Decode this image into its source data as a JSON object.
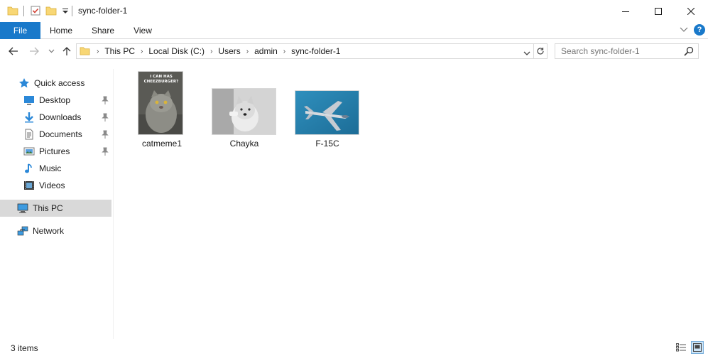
{
  "window": {
    "title": "sync-folder-1",
    "minimize_glyph": "—",
    "maximize_glyph": "☐",
    "close_glyph": "✕"
  },
  "ribbon": {
    "tabs": [
      "File",
      "Home",
      "Share",
      "View"
    ],
    "accent": "#1979ca",
    "help": "?"
  },
  "address": {
    "crumbs": [
      "This PC",
      "Local Disk (C:)",
      "Users",
      "admin",
      "sync-folder-1"
    ]
  },
  "search": {
    "placeholder": "Search sync-folder-1"
  },
  "sidebar": {
    "quick_access": "Quick access",
    "items": [
      {
        "label": "Desktop",
        "icon": "desktop-icon",
        "pinned": true
      },
      {
        "label": "Downloads",
        "icon": "downloads-icon",
        "pinned": true
      },
      {
        "label": "Documents",
        "icon": "documents-icon",
        "pinned": true
      },
      {
        "label": "Pictures",
        "icon": "pictures-icon",
        "pinned": true
      },
      {
        "label": "Music",
        "icon": "music-icon",
        "pinned": false
      },
      {
        "label": "Videos",
        "icon": "videos-icon",
        "pinned": false
      }
    ],
    "this_pc": "This PC",
    "network": "Network"
  },
  "files": [
    {
      "name": "catmeme1",
      "thumb_caption": "I CAN HAS CHEEZBURGER?"
    },
    {
      "name": "Chayka"
    },
    {
      "name": "F-15C"
    }
  ],
  "status": {
    "count": "3 items"
  }
}
